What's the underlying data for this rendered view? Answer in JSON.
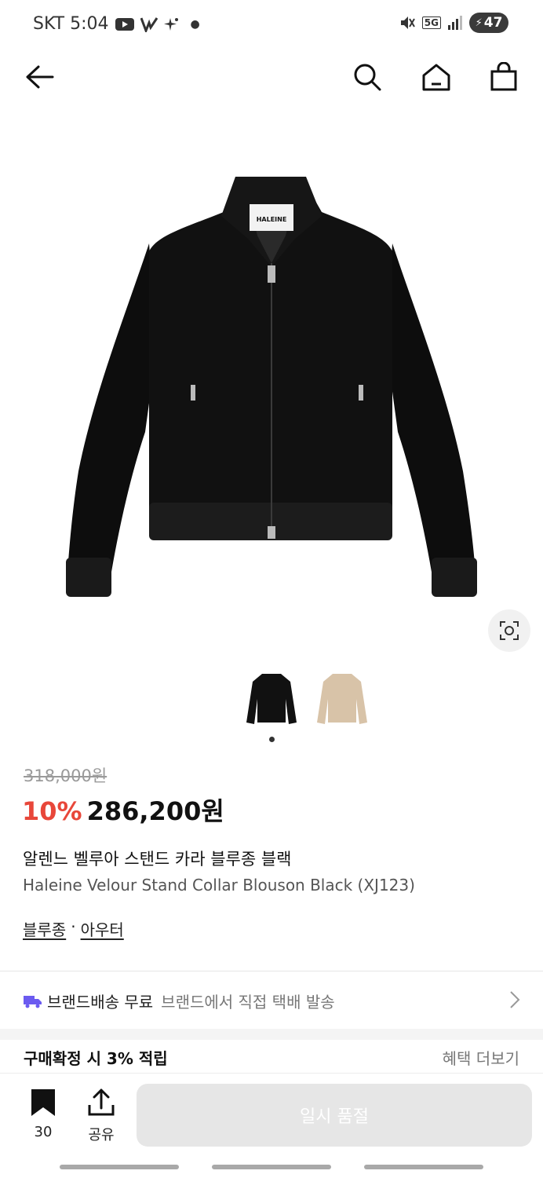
{
  "status_bar": {
    "carrier_time": "SKT 5:04",
    "network": "5G",
    "battery": "47"
  },
  "nav": {
    "back_icon": "arrow-left-icon",
    "search_icon": "search-icon",
    "home_icon": "home-icon",
    "cart_icon": "shopping-bag-icon"
  },
  "product": {
    "brand_label": "HALEINE",
    "original_price": "318,000원",
    "discount": "10%",
    "sale_price": "286,200원",
    "name_ko": "알렌느 벨루아 스탠드 카라 블루종 블랙",
    "name_en": "Haleine Velour Stand Collar Blouson Black (XJ123)",
    "categories": [
      "블루종",
      "아우터"
    ],
    "category_separator": "·"
  },
  "delivery": {
    "title": "브랜드배송 무료",
    "subtitle": "브랜드에서 직접 택배 발송"
  },
  "points": {
    "label": "구매확정 시 3% 적립",
    "more": "혜택 더보기"
  },
  "bottom_bar": {
    "bookmark_count": "30",
    "share_label": "공유",
    "soldout_label": "일시 품절"
  },
  "colors": {
    "discount": "#e8473a",
    "delivery_icon": "#6b5bf0",
    "disabled_button": "#e6e6e6"
  }
}
